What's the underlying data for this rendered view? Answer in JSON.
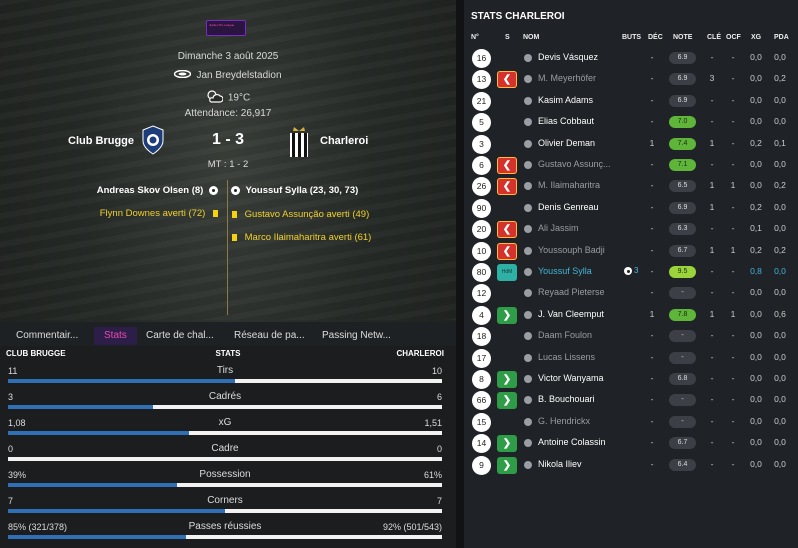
{
  "match": {
    "league_logo": "Jupiler Pro League",
    "date": "Dimanche 3 août 2025",
    "stadium": "Jan Breydelstadion",
    "temperature": "19°C",
    "attendance": "Attendance: 26,917",
    "home_team": "Club Brugge",
    "away_team": "Charleroi",
    "score": "1 - 3",
    "halftime": "MT : 1 - 2",
    "home_scorer": "Andreas Skov Olsen (8)",
    "away_scorer": "Youssuf Sylla (23, 30, 73)",
    "home_cards": [
      "Flynn Downes averti (72)"
    ],
    "away_cards": [
      "Gustavo Assunção averti (49)",
      "Marco Ilaimaharitra averti (61)"
    ]
  },
  "tabs": [
    "Commentair...",
    "Stats",
    "Carte de chal...",
    "Réseau de pa...",
    "Passing Netw..."
  ],
  "active_tab": "Stats",
  "stats": {
    "home_label": "CLUB BRUGGE",
    "center_label": "STATS",
    "away_label": "CHARLEROI",
    "rows": [
      {
        "name": "Tirs",
        "home": "11",
        "away": "10",
        "home_share": 0.524
      },
      {
        "name": "Cadrés",
        "home": "3",
        "away": "6",
        "home_share": 0.333
      },
      {
        "name": "xG",
        "home": "1,08",
        "away": "1,51",
        "home_share": 0.417
      },
      {
        "name": "Cadre",
        "home": "0",
        "away": "0",
        "home_share": 0.0
      },
      {
        "name": "Possession",
        "home": "39%",
        "away": "61%",
        "home_share": 0.39
      },
      {
        "name": "Corners",
        "home": "7",
        "away": "7",
        "home_share": 0.5
      },
      {
        "name": "Passes réussies",
        "home": "85% (321/378)",
        "away": "92% (501/543)",
        "home_share": 0.41
      }
    ]
  },
  "player_stats": {
    "title": "STATS CHARLEROI",
    "columns": [
      "N°",
      "S",
      "NOM",
      "BUTS",
      "DÉC",
      "NOTE",
      "CLÉ",
      "OCF",
      "XG",
      "PDA"
    ],
    "players": [
      {
        "num": "16",
        "sub": "",
        "name": "Devis Vásquez",
        "status": "",
        "buts": "",
        "dec": "-",
        "note": "6.9",
        "note_style": "",
        "cle": "-",
        "ocf": "-",
        "xg": "0,0",
        "pda": "0,0"
      },
      {
        "num": "13",
        "sub": "out",
        "name": "M. Meyerhöfer",
        "status": "dim",
        "buts": "",
        "dec": "-",
        "note": "6.9",
        "note_style": "",
        "cle": "3",
        "ocf": "-",
        "xg": "0,0",
        "pda": "0,2"
      },
      {
        "num": "21",
        "sub": "",
        "name": "Kasim Adams",
        "status": "",
        "buts": "",
        "dec": "-",
        "note": "6.9",
        "note_style": "",
        "cle": "-",
        "ocf": "-",
        "xg": "0,0",
        "pda": "0,0"
      },
      {
        "num": "5",
        "sub": "",
        "name": "Elias Cobbaut",
        "status": "",
        "buts": "",
        "dec": "-",
        "note": "7.0",
        "note_style": "good",
        "cle": "-",
        "ocf": "-",
        "xg": "0,0",
        "pda": "0,0"
      },
      {
        "num": "3",
        "sub": "",
        "name": "Olivier Deman",
        "status": "",
        "buts": "",
        "dec": "1",
        "note": "7.4",
        "note_style": "good",
        "cle": "1",
        "ocf": "-",
        "xg": "0,2",
        "pda": "0,1"
      },
      {
        "num": "6",
        "sub": "out",
        "name": "Gustavo Assunç...",
        "status": "dim",
        "buts": "",
        "dec": "-",
        "note": "7.1",
        "note_style": "good",
        "cle": "-",
        "ocf": "-",
        "xg": "0,0",
        "pda": "0,0"
      },
      {
        "num": "26",
        "sub": "out",
        "name": "M. Ilaimaharitra",
        "status": "dim",
        "buts": "",
        "dec": "-",
        "note": "6.5",
        "note_style": "",
        "cle": "1",
        "ocf": "1",
        "xg": "0,0",
        "pda": "0,2"
      },
      {
        "num": "90",
        "sub": "",
        "name": "Denis Genreau",
        "status": "",
        "buts": "",
        "dec": "-",
        "note": "6.9",
        "note_style": "",
        "cle": "1",
        "ocf": "-",
        "xg": "0,2",
        "pda": "0,0"
      },
      {
        "num": "20",
        "sub": "out",
        "name": "Ali Jassim",
        "status": "dim",
        "buts": "",
        "dec": "-",
        "note": "6.3",
        "note_style": "",
        "cle": "-",
        "ocf": "-",
        "xg": "0,1",
        "pda": "0,0"
      },
      {
        "num": "10",
        "sub": "out",
        "name": "Youssouph Badji",
        "status": "dim",
        "buts": "",
        "dec": "-",
        "note": "6.7",
        "note_style": "",
        "cle": "1",
        "ocf": "1",
        "xg": "0,2",
        "pda": "0,2"
      },
      {
        "num": "80",
        "sub": "mom",
        "name": "Youssuf Sylla",
        "status": "hl",
        "buts": "3",
        "dec": "-",
        "note": "9.5",
        "note_style": "great",
        "cle": "-",
        "ocf": "-",
        "xg": "0,8",
        "pda": "0,0"
      },
      {
        "num": "12",
        "sub": "",
        "name": "Reyaad Pieterse",
        "status": "dim",
        "buts": "",
        "dec": "-",
        "note": "-",
        "note_style": "",
        "cle": "-",
        "ocf": "-",
        "xg": "0,0",
        "pda": "0,0"
      },
      {
        "num": "4",
        "sub": "in",
        "name": "J. Van Cleemput",
        "status": "",
        "buts": "",
        "dec": "1",
        "note": "7.8",
        "note_style": "good",
        "cle": "1",
        "ocf": "1",
        "xg": "0,0",
        "pda": "0,6"
      },
      {
        "num": "18",
        "sub": "",
        "name": "Daam Foulon",
        "status": "dim",
        "buts": "",
        "dec": "-",
        "note": "-",
        "note_style": "",
        "cle": "-",
        "ocf": "-",
        "xg": "0,0",
        "pda": "0,0"
      },
      {
        "num": "17",
        "sub": "",
        "name": "Lucas Lissens",
        "status": "dim",
        "buts": "",
        "dec": "-",
        "note": "-",
        "note_style": "",
        "cle": "-",
        "ocf": "-",
        "xg": "0,0",
        "pda": "0,0"
      },
      {
        "num": "8",
        "sub": "in",
        "name": "Victor Wanyama",
        "status": "",
        "buts": "",
        "dec": "-",
        "note": "6.8",
        "note_style": "",
        "cle": "-",
        "ocf": "-",
        "xg": "0,0",
        "pda": "0,0"
      },
      {
        "num": "66",
        "sub": "in",
        "name": "B. Bouchouari",
        "status": "",
        "buts": "",
        "dec": "-",
        "note": "-",
        "note_style": "",
        "cle": "-",
        "ocf": "-",
        "xg": "0,0",
        "pda": "0,0"
      },
      {
        "num": "15",
        "sub": "",
        "name": "G. Hendrickx",
        "status": "dim",
        "buts": "",
        "dec": "-",
        "note": "-",
        "note_style": "",
        "cle": "-",
        "ocf": "-",
        "xg": "0,0",
        "pda": "0,0"
      },
      {
        "num": "14",
        "sub": "in",
        "name": "Antoine Colassin",
        "status": "",
        "buts": "",
        "dec": "-",
        "note": "6.7",
        "note_style": "",
        "cle": "-",
        "ocf": "-",
        "xg": "0,0",
        "pda": "0,0"
      },
      {
        "num": "9",
        "sub": "in",
        "name": "Nikola Iliev",
        "status": "",
        "buts": "",
        "dec": "-",
        "note": "6.4",
        "note_style": "",
        "cle": "-",
        "ocf": "-",
        "xg": "0,0",
        "pda": "0,0"
      }
    ],
    "mom_badge": "HdM"
  },
  "colors": {
    "home_bar": "#2f6fb6",
    "away_bar": "#f2f2f2",
    "active_tab": "#e84bb0",
    "note_good": "#5fb53a",
    "sub_out": "#d6322c",
    "sub_in": "#2f9c48",
    "highlight": "#43b5d6"
  },
  "icons": {
    "stadium": "stadium-icon",
    "weather": "partly-cloudy-icon",
    "goal": "football-icon",
    "card": "yellow-card-icon",
    "player": "person-icon",
    "sub_out": "arrow-left-icon",
    "sub_in": "arrow-right-icon"
  }
}
